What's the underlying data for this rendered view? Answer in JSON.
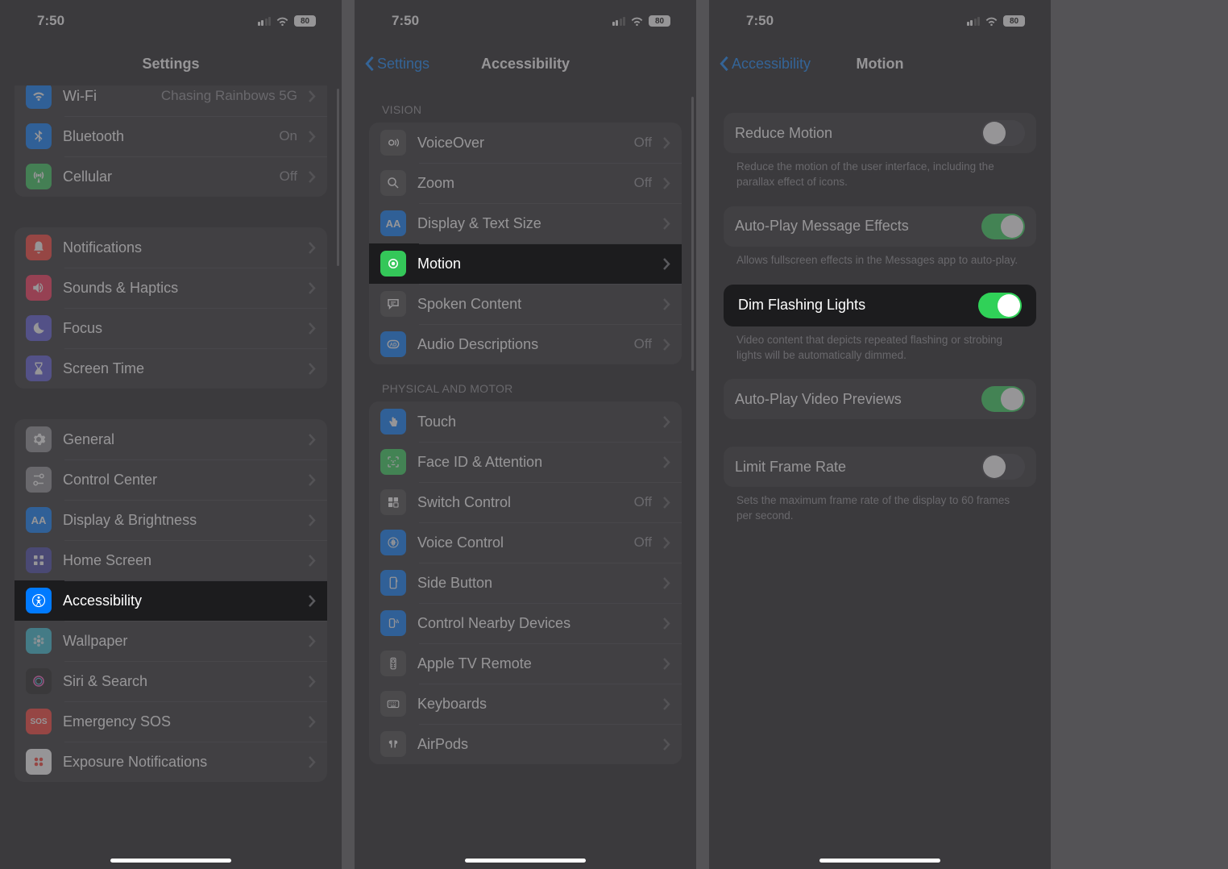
{
  "status": {
    "time": "7:50",
    "battery": "80"
  },
  "phone1": {
    "title": "Settings",
    "top_group": [
      {
        "icon": "wifi",
        "bg": "#007aff",
        "label": "Wi-Fi",
        "value": "Chasing Rainbows 5G"
      },
      {
        "icon": "bluetooth",
        "bg": "#007aff",
        "label": "Bluetooth",
        "value": "On"
      },
      {
        "icon": "cellular",
        "bg": "#34c759",
        "label": "Cellular",
        "value": "Off"
      }
    ],
    "group2": [
      {
        "icon": "bell",
        "bg": "#ff3b30",
        "label": "Notifications"
      },
      {
        "icon": "speaker",
        "bg": "#ff2d55",
        "label": "Sounds & Haptics"
      },
      {
        "icon": "moon",
        "bg": "#5856d6",
        "label": "Focus"
      },
      {
        "icon": "hourglass",
        "bg": "#5856d6",
        "label": "Screen Time"
      }
    ],
    "group3": [
      {
        "icon": "gear",
        "bg": "#8e8e93",
        "label": "General"
      },
      {
        "icon": "switches",
        "bg": "#8e8e93",
        "label": "Control Center"
      },
      {
        "icon": "AA",
        "bg": "#007aff",
        "label": "Display & Brightness"
      },
      {
        "icon": "grid",
        "bg": "#5451b5",
        "label": "Home Screen"
      },
      {
        "icon": "accessibility",
        "bg": "#007aff",
        "label": "Accessibility",
        "highlight": true
      },
      {
        "icon": "flower",
        "bg": "#33bed5",
        "label": "Wallpaper"
      },
      {
        "icon": "siri",
        "bg": "#000",
        "label": "Siri & Search"
      },
      {
        "icon": "sos",
        "bg": "#ff3b30",
        "label": "Emergency SOS"
      },
      {
        "icon": "exposure",
        "bg": "#fff",
        "label": "Exposure Notifications"
      }
    ]
  },
  "phone2": {
    "back": "Settings",
    "title": "Accessibility",
    "section1": "VISION",
    "group1": [
      {
        "icon": "voiceover",
        "bg": "#444",
        "label": "VoiceOver",
        "value": "Off"
      },
      {
        "icon": "zoom",
        "bg": "#444",
        "label": "Zoom",
        "value": "Off"
      },
      {
        "icon": "AA",
        "bg": "#007aff",
        "label": "Display & Text Size"
      },
      {
        "icon": "motion",
        "bg": "#34c759",
        "label": "Motion",
        "highlight": true
      },
      {
        "icon": "speech",
        "bg": "#444",
        "label": "Spoken Content"
      },
      {
        "icon": "audio-desc",
        "bg": "#007aff",
        "label": "Audio Descriptions",
        "value": "Off"
      }
    ],
    "section2": "PHYSICAL AND MOTOR",
    "group2": [
      {
        "icon": "touch",
        "bg": "#007aff",
        "label": "Touch"
      },
      {
        "icon": "face-id",
        "bg": "#30d158",
        "label": "Face ID & Attention"
      },
      {
        "icon": "switch",
        "bg": "#444",
        "label": "Switch Control",
        "value": "Off"
      },
      {
        "icon": "voice-ctrl",
        "bg": "#007aff",
        "label": "Voice Control",
        "value": "Off"
      },
      {
        "icon": "side-btn",
        "bg": "#007aff",
        "label": "Side Button"
      },
      {
        "icon": "nearby",
        "bg": "#007aff",
        "label": "Control Nearby Devices"
      },
      {
        "icon": "tv",
        "bg": "#444",
        "label": "Apple TV Remote"
      },
      {
        "icon": "keyboard",
        "bg": "#444",
        "label": "Keyboards"
      },
      {
        "icon": "airpods",
        "bg": "#444",
        "label": "AirPods"
      }
    ]
  },
  "phone3": {
    "back": "Accessibility",
    "title": "Motion",
    "rows": [
      {
        "label": "Reduce Motion",
        "on": false,
        "footer": "Reduce the motion of the user interface, including the parallax effect of icons."
      },
      {
        "label": "Auto-Play Message Effects",
        "on": true,
        "footer": "Allows fullscreen effects in the Messages app to auto-play."
      },
      {
        "label": "Dim Flashing Lights",
        "on": true,
        "highlight": true,
        "footer": "Video content that depicts repeated flashing or strobing lights will be automatically dimmed."
      },
      {
        "label": "Auto-Play Video Previews",
        "on": true,
        "footer": ""
      },
      {
        "label": "Limit Frame Rate",
        "on": false,
        "footer": "Sets the maximum frame rate of the display to 60 frames per second."
      }
    ]
  }
}
